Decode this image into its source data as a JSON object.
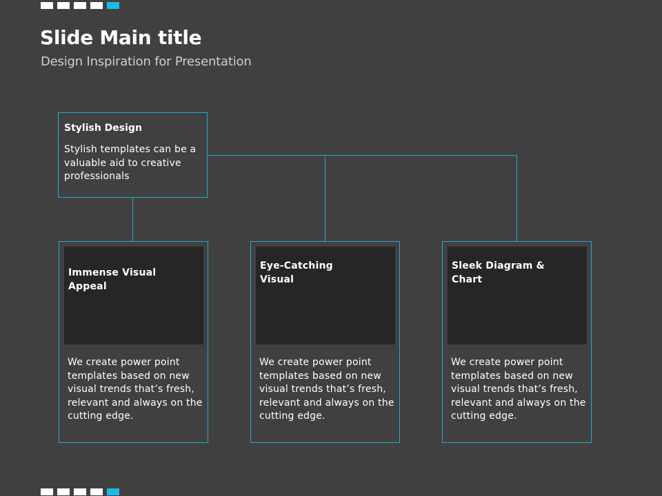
{
  "slide": {
    "title": "Slide Main title",
    "subtitle": "Design Inspiration for Presentation"
  },
  "colors": {
    "background": "#404040",
    "accent": "#1ebbea",
    "panel": "#262626",
    "text": "#ffffff"
  },
  "top_box": {
    "title": "Stylish Design",
    "text": "Stylish templates can be a valuable aid to creative professionals"
  },
  "cards": [
    {
      "title": "Immense Visual Appeal",
      "text": "We create power point templates based on new visual trends that’s fresh, relevant and always on the cutting edge."
    },
    {
      "title": "Eye-Catching Visual",
      "text": "We create power point templates based on new visual trends that’s fresh, relevant and always on the cutting edge."
    },
    {
      "title": "Sleek Diagram & Chart",
      "text": "We create power point templates based on new visual trends that’s fresh, relevant and always on the cutting edge."
    }
  ]
}
